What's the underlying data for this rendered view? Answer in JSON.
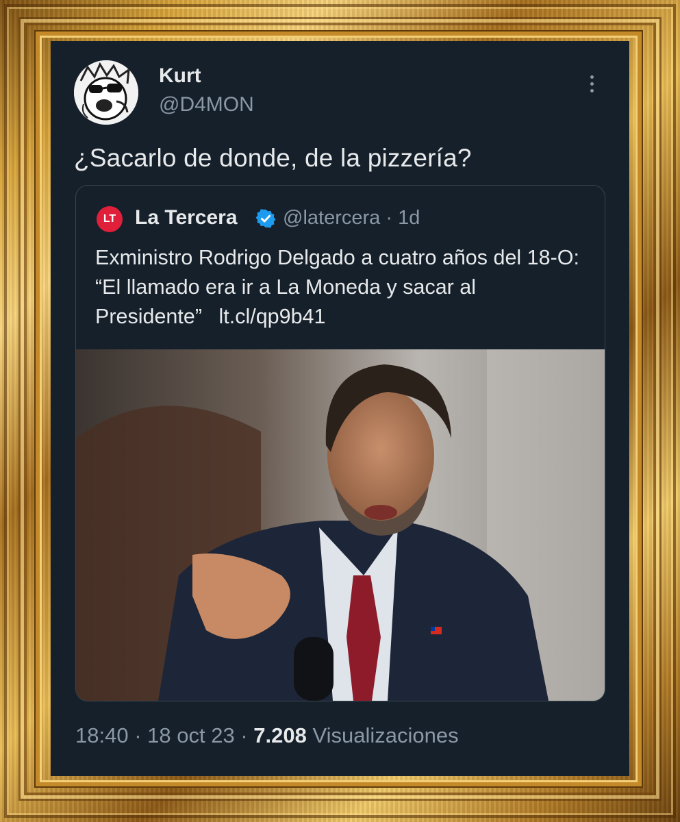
{
  "tweet": {
    "author_name": "Kurt",
    "author_handle": "@D4MON",
    "text": "¿Sacarlo de donde, de la pizzería?",
    "more_icon": "more-vertical-icon"
  },
  "quoted": {
    "logo_text": "LT",
    "author_name": "La Tercera",
    "verified_icon": "verified-badge-icon",
    "author_handle": "@latercera",
    "separator": "·",
    "age": "1d",
    "text": "Exministro Rodrigo Delgado a cuatro años del 18-O: “El llamado era ir a La Moneda y sacar al Presidente”",
    "link": "lt.cl/qp9b41"
  },
  "footer": {
    "time": "18:40",
    "date": "18 oct 23",
    "separator": "·",
    "views_count": "7.208",
    "views_label": "Visualizaciones"
  },
  "colors": {
    "background": "#15202b",
    "primary_text": "#e7e9ea",
    "secondary_text": "#8b98a5",
    "verified": "#1d9bf0",
    "brand_red": "#e0203a",
    "frame_gold": "#d8a43a"
  }
}
